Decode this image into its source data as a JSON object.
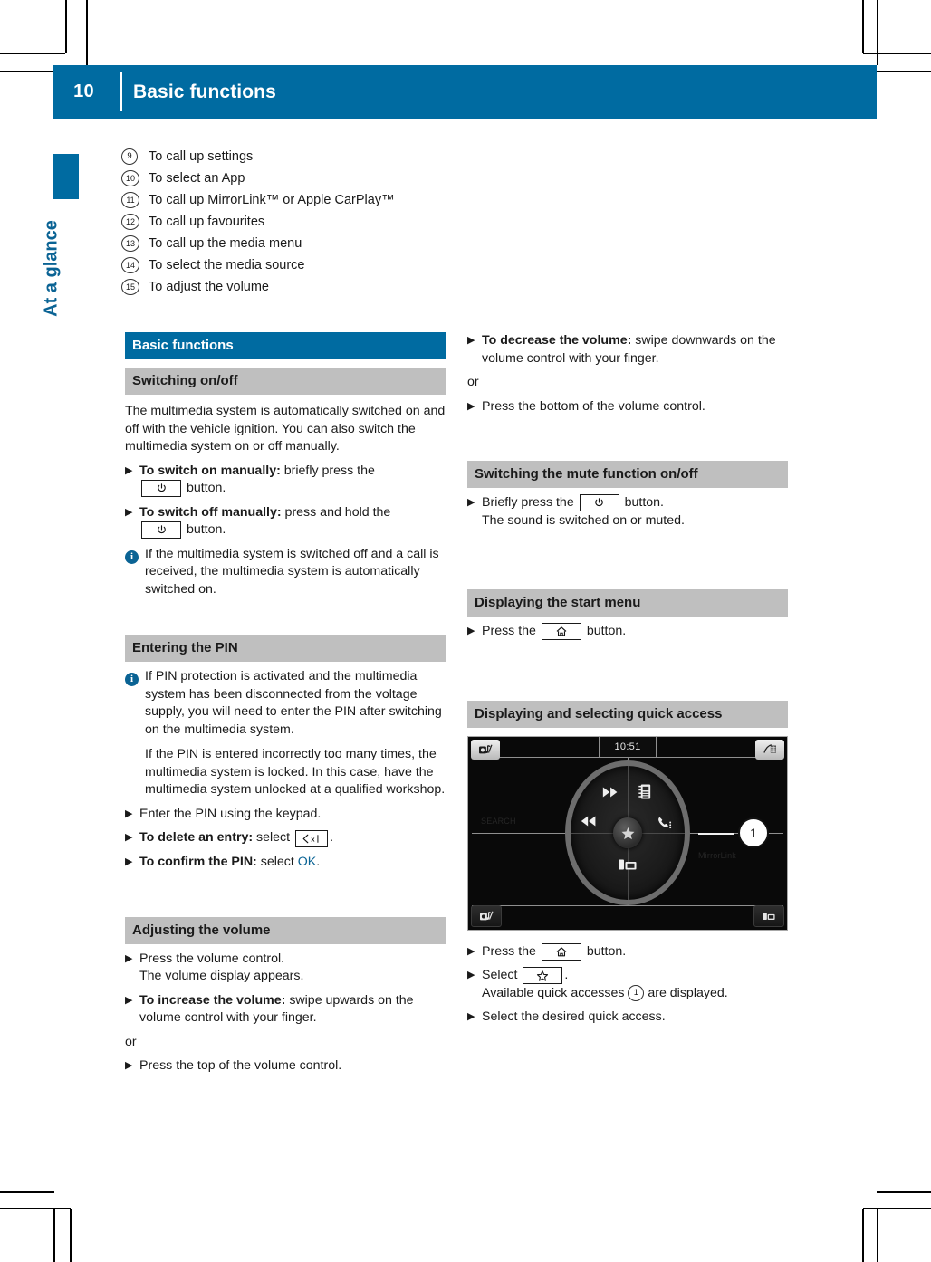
{
  "header": {
    "page_number": "10",
    "title": "Basic functions"
  },
  "side_tab": {
    "label": "At a glance"
  },
  "legend": {
    "items": [
      {
        "num": "9",
        "text": "To call up settings"
      },
      {
        "num": "10",
        "text": "To select an App"
      },
      {
        "num": "11",
        "text": "To call up MirrorLink™ or Apple CarPlay™"
      },
      {
        "num": "12",
        "text": "To call up favourites"
      },
      {
        "num": "13",
        "text": "To call up the media menu"
      },
      {
        "num": "14",
        "text": "To select the media source"
      },
      {
        "num": "15",
        "text": "To adjust the volume"
      }
    ]
  },
  "left_column": {
    "section_title": "Basic functions",
    "switching_heading": "Switching on/off",
    "switching_paragraph": "The multimedia system is automatically switched on and off with the vehicle ignition. You can also switch the multimedia system on or off manually.",
    "step_switch_on_bold": "To switch on manually:",
    "step_switch_on_rest": " briefly press the",
    "step_switch_on_tail": " button.",
    "step_switch_off_bold": "To switch off manually:",
    "step_switch_off_rest": " press and hold the",
    "step_switch_off_tail": " button.",
    "note_switch_off": "If the multimedia system is switched off and a call is received, the multimedia system is automatically switched on.",
    "pin_heading": "Entering the PIN",
    "pin_note_1": "If PIN protection is activated and the multimedia system has been disconnected from the voltage supply, you will need to enter the PIN after switching on the multimedia system.",
    "pin_note_2": "If the PIN is entered incorrectly too many times, the multimedia system is locked. In this case, have the multimedia system unlocked at a qualified workshop.",
    "step_enter_pin": "Enter the PIN using the keypad.",
    "step_delete_bold": "To delete an entry:",
    "step_delete_rest": " select",
    "step_delete_tail": ".",
    "step_confirm_bold": "To confirm the PIN:",
    "step_confirm_rest": " select ",
    "step_confirm_token": "OK",
    "step_confirm_tail": ".",
    "volume_heading": "Adjusting the volume",
    "step_press_volume": "Press the volume control.",
    "step_press_volume_sub": "The volume display appears.",
    "step_increase_bold": "To increase the volume:",
    "step_increase_rest": " swipe upwards on the volume control with your finger.",
    "or_word": "or",
    "step_press_top": "Press the top of the volume control."
  },
  "right_column": {
    "step_decrease_bold": "To decrease the volume:",
    "step_decrease_rest": " swipe downwards on the volume control with your finger.",
    "or_word": "or",
    "step_press_bottom": "Press the bottom of the volume control.",
    "mute_heading": "Switching the mute function on/off",
    "step_mute_pre": "Briefly press the",
    "step_mute_post": " button.",
    "step_mute_sub": "The sound is switched on or muted.",
    "start_menu_heading": "Displaying the start menu",
    "step_start_pre": "Press the",
    "step_start_post": " button.",
    "quick_access_heading": "Displaying and selecting quick access",
    "step_qa_press_pre": "Press the",
    "step_qa_press_post": " button.",
    "step_qa_select_pre": "Select",
    "step_qa_select_post": ".",
    "step_qa_sub_pre": "Available quick accesses ",
    "step_qa_sub_num": "1",
    "step_qa_sub_post": " are displayed.",
    "step_qa_desired": "Select the desired quick access."
  },
  "display_screenshot": {
    "clock": "10:51",
    "callout_number": "1",
    "corner_icons": {
      "top_left": "radio-mute-icon",
      "top_right": "navigation-icon",
      "bottom_left": "media-mute-icon",
      "bottom_right": "media-device-icon"
    },
    "wheel_icons": {
      "upper_left": "fast-forward-icon",
      "lower_left": "rewind-icon",
      "upper_right": "phonebook-icon",
      "lower_right": "telephone-icon",
      "bottom": "media-device-icon",
      "hub": "star-icon"
    },
    "ghost_labels": [
      "SEARCH",
      "MirrorLink"
    ]
  },
  "icons": {
    "power": "power-icon",
    "home": "home-icon",
    "star": "star-icon",
    "backspace": "backspace-icon"
  },
  "colors": {
    "brand_blue": "#006ba1",
    "tab_blue": "#0a6394",
    "subhead_gray": "#bfbfbf"
  }
}
